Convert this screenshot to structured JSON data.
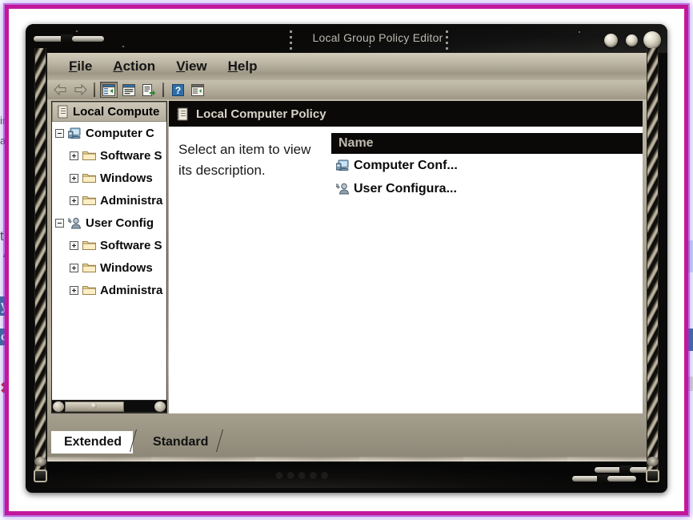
{
  "window": {
    "title": "Local Group Policy Editor",
    "controls": [
      {
        "name": "minimize-button",
        "label": "Minimize"
      },
      {
        "name": "maximize-button",
        "label": "Maximize"
      },
      {
        "name": "close-button",
        "label": "Close"
      }
    ]
  },
  "menubar": {
    "items": [
      {
        "accel": "F",
        "rest": "ile",
        "name": "menu-file"
      },
      {
        "accel": "A",
        "rest": "ction",
        "name": "menu-action"
      },
      {
        "accel": "V",
        "rest": "iew",
        "name": "menu-view"
      },
      {
        "accel": "H",
        "rest": "elp",
        "name": "menu-help"
      }
    ]
  },
  "toolbar": {
    "buttons": [
      {
        "name": "back-button",
        "icon": "left-arrow-icon",
        "label": "Back",
        "pressed": false
      },
      {
        "name": "forward-button",
        "icon": "right-arrow-icon",
        "label": "Forward",
        "pressed": false
      },
      {
        "name": "show-hide-tree-button",
        "icon": "console-tree-icon",
        "label": "Show/Hide Console Tree",
        "pressed": true
      },
      {
        "name": "properties-button",
        "icon": "properties-icon",
        "label": "Properties",
        "pressed": false
      },
      {
        "name": "export-list-button",
        "icon": "export-list-icon",
        "label": "Export List",
        "pressed": false
      },
      {
        "name": "help-button",
        "icon": "question-mark-icon",
        "label": "Help",
        "pressed": false
      },
      {
        "name": "show-pane-button",
        "icon": "action-pane-icon",
        "label": "Show/Hide Action Pane",
        "pressed": false
      }
    ]
  },
  "tree": {
    "root": {
      "label": "Local Compute",
      "icon": "policy-scroll-icon",
      "selected": true
    },
    "nodes": [
      {
        "label": "Computer C",
        "icon": "computer-icon",
        "indent": 0,
        "state": "expanded",
        "name": "tree-node-computer-configuration"
      },
      {
        "label": "Software S",
        "icon": "folder-icon",
        "indent": 1,
        "state": "collapsed",
        "name": "tree-node-computer-software-settings"
      },
      {
        "label": "Windows",
        "icon": "folder-icon",
        "indent": 1,
        "state": "collapsed",
        "name": "tree-node-computer-windows-settings"
      },
      {
        "label": "Administra",
        "icon": "folder-icon",
        "indent": 1,
        "state": "collapsed",
        "name": "tree-node-computer-administrative-templates"
      },
      {
        "label": "User Config",
        "icon": "user-icon",
        "indent": 0,
        "state": "expanded",
        "name": "tree-node-user-configuration"
      },
      {
        "label": "Software S",
        "icon": "folder-icon",
        "indent": 1,
        "state": "collapsed",
        "name": "tree-node-user-software-settings"
      },
      {
        "label": "Windows",
        "icon": "folder-icon",
        "indent": 1,
        "state": "collapsed",
        "name": "tree-node-user-windows-settings"
      },
      {
        "label": "Administra",
        "icon": "folder-icon",
        "indent": 1,
        "state": "collapsed",
        "name": "tree-node-user-administrative-templates"
      }
    ]
  },
  "content": {
    "header": "Local Computer Policy",
    "header_icon": "policy-scroll-icon",
    "description": "Select an item to view its description.",
    "column_header": "Name",
    "rows": [
      {
        "label": "Computer Conf...",
        "icon": "computer-icon",
        "name": "list-item-computer-configuration"
      },
      {
        "label": "User Configura...",
        "icon": "user-icon",
        "name": "list-item-user-configuration"
      }
    ]
  },
  "tabs": [
    {
      "label": "Extended",
      "active": true,
      "name": "tab-extended"
    },
    {
      "label": "Standard",
      "active": false,
      "name": "tab-standard"
    }
  ],
  "background_fragments": [
    {
      "text": "in",
      "name": "bg-fragment-1"
    },
    {
      "text": "al",
      "name": "bg-fragment-2"
    },
    {
      "text": "t",
      "name": "bg-fragment-3"
    },
    {
      "text": "y",
      "name": "bg-fragment-4"
    },
    {
      "text": "ck",
      "name": "bg-fragment-5"
    }
  ],
  "colors": {
    "frame_accent": "#c2179b",
    "window_dark": "#0a0a0a",
    "console_chrome": "#b9b2a1",
    "pane_white": "#ffffff",
    "header_text": "#d8d3c8"
  }
}
